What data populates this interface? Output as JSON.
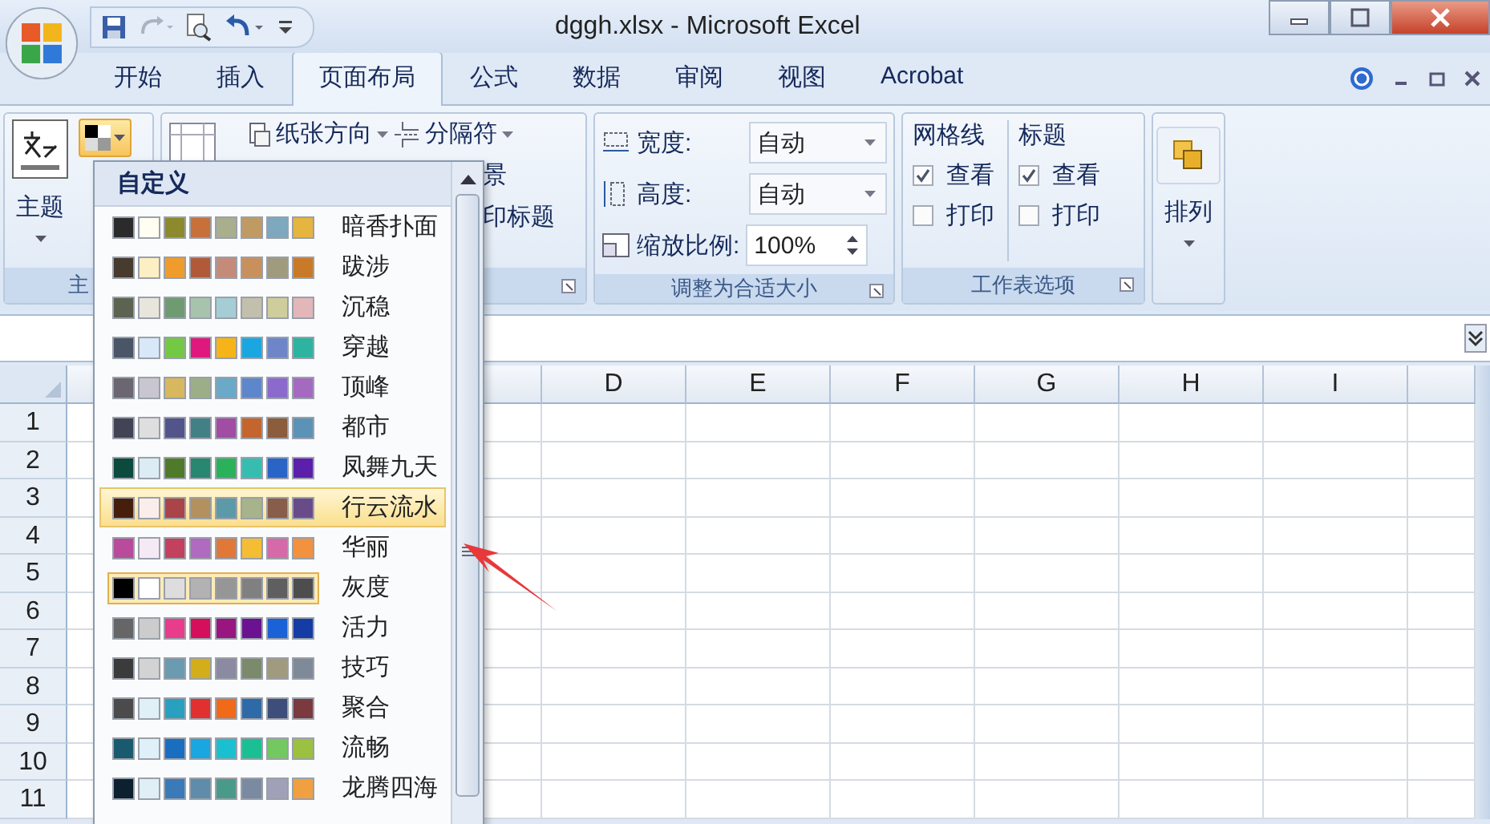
{
  "window": {
    "title": "dggh.xlsx - Microsoft Excel"
  },
  "tabs": [
    {
      "label": "开始",
      "selected": false
    },
    {
      "label": "插入",
      "selected": false
    },
    {
      "label": "页面布局",
      "selected": true
    },
    {
      "label": "公式",
      "selected": false
    },
    {
      "label": "数据",
      "selected": false
    },
    {
      "label": "审阅",
      "selected": false
    },
    {
      "label": "视图",
      "selected": false
    },
    {
      "label": "Acrobat",
      "selected": false
    }
  ],
  "ribbon": {
    "themes": {
      "button": "主题",
      "label": "主"
    },
    "page_setup": {
      "orientation": "纸张方向",
      "breaks": "分隔符",
      "background": "景",
      "print_titles": "印标题"
    },
    "scale": {
      "width_label": "宽度:",
      "width_value": "自动",
      "height_label": "高度:",
      "height_value": "自动",
      "scale_label": "缩放比例:",
      "scale_value": "100%",
      "label": "调整为合适大小"
    },
    "sheet_options": {
      "groups": [
        {
          "title": "网格线",
          "view": {
            "label": "查看",
            "checked": true
          },
          "print": {
            "label": "打印",
            "checked": false
          }
        },
        {
          "title": "标题",
          "view": {
            "label": "查看",
            "checked": true
          },
          "print": {
            "label": "打印",
            "checked": false
          }
        }
      ],
      "label": "工作表选项"
    },
    "arrange": {
      "button": "排列"
    }
  },
  "columns": [
    "D",
    "E",
    "F",
    "G",
    "H",
    "I"
  ],
  "rows": [
    "1",
    "2",
    "3",
    "4",
    "5",
    "6",
    "7",
    "8",
    "9",
    "10",
    "11"
  ],
  "color_menu": {
    "header": "自定义",
    "themes": [
      {
        "name": "暗香扑面",
        "swatches": [
          {
            "color": "#2b2b2b"
          },
          {
            "color": "#fffef0"
          },
          {
            "color": "#8b8a2c"
          },
          {
            "color": "#c8703a"
          },
          {
            "color": "#a9ae8e"
          },
          {
            "color": "#c09a63"
          },
          {
            "color": "#7ea8be"
          },
          {
            "color": "#e6b53f"
          }
        ],
        "highlighted": false,
        "current": false
      },
      {
        "name": "跋涉",
        "swatches": [
          {
            "color": "#473a2e"
          },
          {
            "color": "#fcefc4"
          },
          {
            "color": "#ef9c2c"
          },
          {
            "color": "#b15a3a"
          },
          {
            "color": "#c58b7a"
          },
          {
            "color": "#c8905d"
          },
          {
            "color": "#a09a7e"
          },
          {
            "color": "#c87a28"
          }
        ],
        "highlighted": false,
        "current": false
      },
      {
        "name": "沉稳",
        "swatches": [
          {
            "color": "#5c6350"
          },
          {
            "color": "#e8e6dc"
          },
          {
            "color": "#6f9b72"
          },
          {
            "color": "#a8c3ac"
          },
          {
            "color": "#a5cdd5"
          },
          {
            "color": "#c2c0ac"
          },
          {
            "color": "#d0cd9c"
          },
          {
            "color": "#e2b7b9"
          }
        ],
        "highlighted": false,
        "current": false
      },
      {
        "name": "穿越",
        "swatches": [
          {
            "color": "#4a5568"
          },
          {
            "color": "#d9e8f8"
          },
          {
            "color": "#74c944"
          },
          {
            "color": "#e0187d"
          },
          {
            "color": "#f6b418"
          },
          {
            "color": "#1aa6e0"
          },
          {
            "color": "#6e86c8"
          },
          {
            "color": "#2cb4a0"
          }
        ],
        "highlighted": false,
        "current": false
      },
      {
        "name": "顶峰",
        "swatches": [
          {
            "color": "#6b6670"
          },
          {
            "color": "#c9c6cf"
          },
          {
            "color": "#d8b85e"
          },
          {
            "color": "#9cae88"
          },
          {
            "color": "#6aa9c8"
          },
          {
            "color": "#5e86cc"
          },
          {
            "color": "#8a6acd"
          },
          {
            "color": "#a46ac0"
          }
        ],
        "highlighted": false,
        "current": false
      },
      {
        "name": "都市",
        "swatches": [
          {
            "color": "#424456"
          },
          {
            "color": "#dedede"
          },
          {
            "color": "#53548a"
          },
          {
            "color": "#438086"
          },
          {
            "color": "#a04da3"
          },
          {
            "color": "#c4652d"
          },
          {
            "color": "#8b5d3d"
          },
          {
            "color": "#5c92b5"
          }
        ],
        "highlighted": false,
        "current": false
      },
      {
        "name": "凤舞九天",
        "swatches": [
          {
            "color": "#0c4a3e"
          },
          {
            "color": "#dcecf4"
          },
          {
            "color": "#4f7a2a"
          },
          {
            "color": "#27876f"
          },
          {
            "color": "#2ab25a"
          },
          {
            "color": "#36bdb0"
          },
          {
            "color": "#2a64c6"
          },
          {
            "color": "#5b1fac"
          }
        ],
        "highlighted": false,
        "current": false
      },
      {
        "name": "行云流水",
        "swatches": [
          {
            "color": "#461f0c"
          },
          {
            "color": "#fbeeea"
          },
          {
            "color": "#a94448"
          },
          {
            "color": "#b3915e"
          },
          {
            "color": "#5d9aa8"
          },
          {
            "color": "#a7b38a"
          },
          {
            "color": "#885d49"
          },
          {
            "color": "#6a4b8a"
          }
        ],
        "highlighted": true,
        "current": false
      },
      {
        "name": "华丽",
        "swatches": [
          {
            "color": "#b84b9c"
          },
          {
            "color": "#f6e9f6"
          },
          {
            "color": "#c2415e"
          },
          {
            "color": "#b06abf"
          },
          {
            "color": "#e0783a"
          },
          {
            "color": "#f5bd34"
          },
          {
            "color": "#d56aa8"
          },
          {
            "color": "#f2913e"
          }
        ],
        "highlighted": false,
        "current": false
      },
      {
        "name": "灰度",
        "swatches": [
          {
            "color": "#000000"
          },
          {
            "color": "#ffffff"
          },
          {
            "color": "#dddddd"
          },
          {
            "color": "#b2b2b2"
          },
          {
            "color": "#969696"
          },
          {
            "color": "#808080"
          },
          {
            "color": "#5f5f5f"
          },
          {
            "color": "#4d4d4d"
          }
        ],
        "highlighted": false,
        "current": true
      },
      {
        "name": "活力",
        "swatches": [
          {
            "color": "#666666"
          },
          {
            "color": "#cccccc"
          },
          {
            "color": "#e83c8c"
          },
          {
            "color": "#d4105a"
          },
          {
            "color": "#99157f"
          },
          {
            "color": "#6a1290"
          },
          {
            "color": "#1a62d6"
          },
          {
            "color": "#143ca4"
          }
        ],
        "highlighted": false,
        "current": false
      },
      {
        "name": "技巧",
        "swatches": [
          {
            "color": "#3b3b3b"
          },
          {
            "color": "#d3d3d3"
          },
          {
            "color": "#6a9bb0"
          },
          {
            "color": "#d4ae1a"
          },
          {
            "color": "#8a8aa0"
          },
          {
            "color": "#7a8a6a"
          },
          {
            "color": "#a09a7e"
          },
          {
            "color": "#7e8a98"
          }
        ],
        "highlighted": false,
        "current": false
      },
      {
        "name": "聚合",
        "swatches": [
          {
            "color": "#4b4b4b"
          },
          {
            "color": "#dff0f6"
          },
          {
            "color": "#2aa0c0"
          },
          {
            "color": "#e03030"
          },
          {
            "color": "#f06a1a"
          },
          {
            "color": "#2f6aa8"
          },
          {
            "color": "#3d4e7a"
          },
          {
            "color": "#7a3a40"
          }
        ],
        "highlighted": false,
        "current": false
      },
      {
        "name": "流畅",
        "swatches": [
          {
            "color": "#1a5a6e"
          },
          {
            "color": "#dff0f8"
          },
          {
            "color": "#1a6ec0"
          },
          {
            "color": "#1aa6e0"
          },
          {
            "color": "#1ac0d0"
          },
          {
            "color": "#1ac094"
          },
          {
            "color": "#74c860"
          },
          {
            "color": "#9cc040"
          }
        ],
        "highlighted": false,
        "current": false
      },
      {
        "name": "龙腾四海",
        "swatches": [
          {
            "color": "#0c2030"
          },
          {
            "color": "#e0eef6"
          },
          {
            "color": "#3a7ab8"
          },
          {
            "color": "#5f8ca8"
          },
          {
            "color": "#4a9a8a"
          },
          {
            "color": "#7a8aa0"
          },
          {
            "color": "#a0a0b8"
          },
          {
            "color": "#f0a040"
          }
        ],
        "highlighted": false,
        "current": false
      }
    ]
  }
}
